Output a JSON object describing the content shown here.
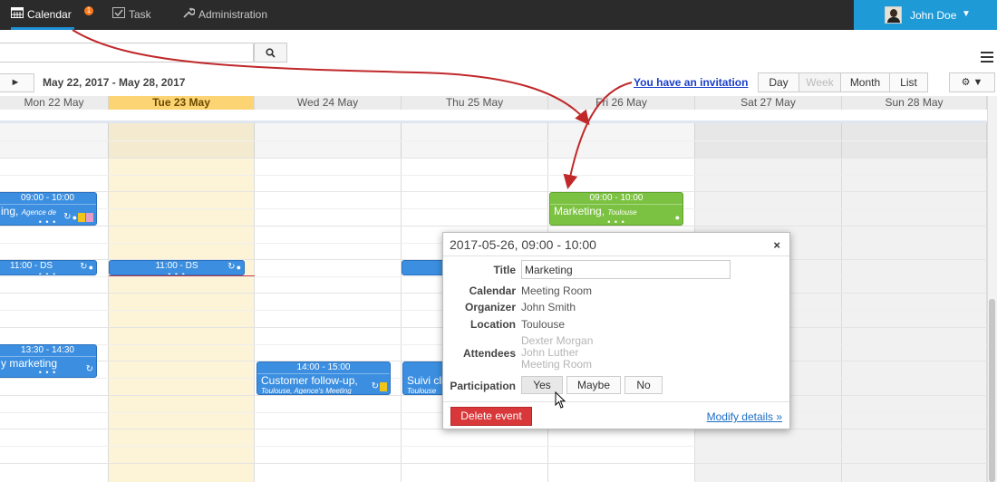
{
  "nav": {
    "calendar_label": "Calendar",
    "calendar_badge": "1",
    "task_label": "Task",
    "admin_label": "Administration",
    "user_name": "John Doe",
    "user_caret": "▼"
  },
  "search": {
    "value": "",
    "button_icon": "search-icon"
  },
  "toolbar": {
    "next_label": "►",
    "date_range": "May 22, 2017 - May 28, 2017",
    "invite_link": "You have an invitation",
    "views": [
      "Day",
      "Week",
      "Month",
      "List"
    ],
    "active_view": "Week",
    "settings_label": "⚙ ▼"
  },
  "days": [
    "Mon 22 May",
    "Tue 23 May",
    "Wed 24 May",
    "Thu 25 May",
    "Fri 26 May",
    "Sat 27 May",
    "Sun 28 May"
  ],
  "today": "Tue 23 May",
  "events": {
    "mon_0900": {
      "time": "09:00 - 10:00",
      "title": "ing,",
      "location": "Agence de"
    },
    "mon_1100": {
      "time": "11:00 - DS"
    },
    "tue_1100": {
      "time": "11:00 - DS"
    },
    "mon_1330": {
      "time": "13:30 - 14:30",
      "title": "y marketing"
    },
    "wed_1400": {
      "time": "14:00 - 15:00",
      "title": "Customer follow-up,",
      "location": "Toulouse, Agence's Meeting"
    },
    "thu_1400": {
      "title": "Suivi cli",
      "location": "Toulouse"
    },
    "fri_0900": {
      "time": "09:00 - 10:00",
      "title": "Marketing,",
      "location": "Toulouse"
    },
    "dots": "• • •"
  },
  "popup": {
    "title": "2017-05-26, 09:00 - 10:00",
    "close": "×",
    "labels": {
      "title": "Title",
      "calendar": "Calendar",
      "organizer": "Organizer",
      "location": "Location",
      "attendees": "Attendees",
      "participation": "Participation"
    },
    "title_value": "Marketing",
    "calendar": "Meeting Room",
    "organizer": "John Smith",
    "location": "Toulouse",
    "attendees": [
      "Dexter Morgan",
      "John Luther",
      "Meeting Room"
    ],
    "participation": [
      "Yes",
      "Maybe",
      "No"
    ],
    "delete_label": "Delete event",
    "modify_label": "Modify details »"
  },
  "colors": {
    "nav_bg": "#2b2b2b",
    "user_bg": "#1e9ad6",
    "event_blue": "#3c8fe0",
    "event_green": "#7cc242",
    "today_header": "#fcd473",
    "delete": "#d8383a",
    "arrow": "#c0282a"
  }
}
